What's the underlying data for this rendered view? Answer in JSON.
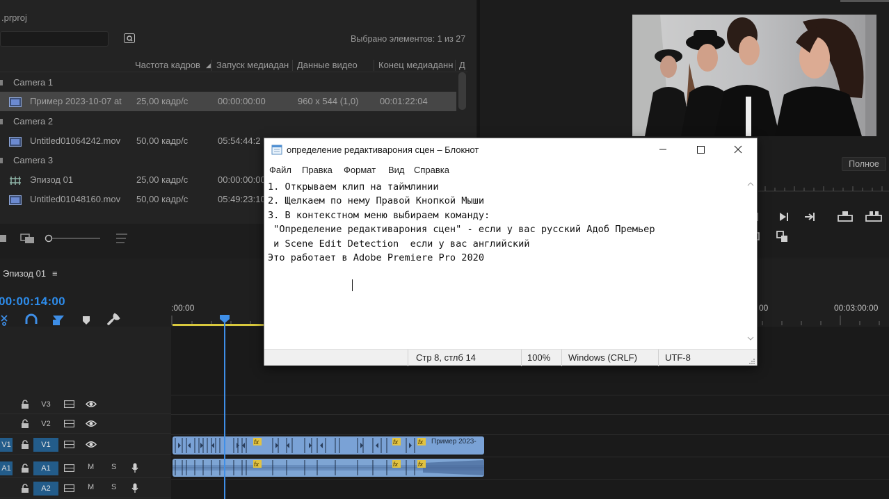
{
  "project": {
    "title": ".prproj",
    "selected_count": "Выбрано элементов: 1 из 27",
    "columns": [
      "Частота кадров",
      "Запуск медиадан",
      "Данные видео",
      "Конец медиаданн",
      "Д"
    ],
    "rows": [
      {
        "bin": "Camera 1"
      },
      {
        "name": "Пример 2023-10-07 at",
        "fps": "25,00 кадр/с",
        "start": "00:00:00:00",
        "video": "960 x 544 (1,0)",
        "end": "00:01:22:04"
      },
      {
        "bin": "Camera 2"
      },
      {
        "name": "Untitled01064242.mov",
        "fps": "50,00 кадр/с",
        "start": "05:54:44:2"
      },
      {
        "bin": "Camera 3"
      },
      {
        "name": "Эпизод 01",
        "fps": "25,00 кадр/с",
        "start": "00:00:00:00"
      },
      {
        "name": "Untitled01048160.mov",
        "fps": "50,00 кадр/с",
        "start": "05:49:23:10"
      }
    ]
  },
  "monitor": {
    "fit": "Полное"
  },
  "timeline": {
    "sequence_tab": "Эпизод 01",
    "timecode": "00:00:14:00",
    "ruler_labels": [
      ":00:00",
      "00",
      "00:03:00:00"
    ],
    "tracks": {
      "v3": "V3",
      "v2": "V2",
      "v1": "V1",
      "v1_src": "V1",
      "a1": "A1",
      "a1_src": "A1",
      "a2": "A2",
      "mute": "M",
      "solo": "S"
    },
    "clip_label": "Пример 2023-"
  },
  "notepad": {
    "title": "определение редактиварония сцен – Блокнот",
    "menu": [
      "Файл",
      "Правка",
      "Формат",
      "Вид",
      "Справка"
    ],
    "lines": [
      "1. Открываем клип на таймлинии",
      "2. Щелкаем по нему Правой Кнопкой Мыши",
      "3. В контекстном меню выбираем команду:",
      "",
      " \"Определение редактиварония сцен\" - если у вас русский Адоб Премьер",
      " и Scene Edit Detection  если у вас английский",
      "",
      "Это работает в Adobe Premiere Pro 2020"
    ],
    "status": {
      "position": "Стр 8, стлб 14",
      "zoom": "100%",
      "eol": "Windows (CRLF)",
      "encoding": "UTF-8"
    }
  }
}
